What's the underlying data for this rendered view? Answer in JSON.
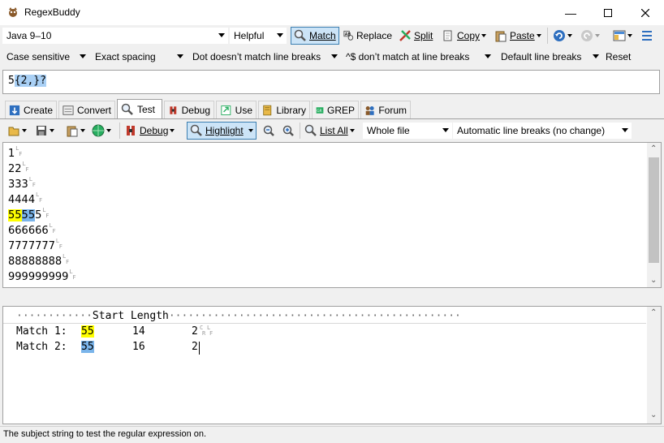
{
  "window": {
    "title": "RegexBuddy"
  },
  "toolbar1": {
    "flavor": "Java 9–10",
    "helpful": "Helpful",
    "match": "Match",
    "replace": "Replace",
    "split": "Split",
    "copy": "Copy",
    "paste": "Paste"
  },
  "toolbar2": {
    "case": "Case sensitive",
    "spacing": "Exact spacing",
    "dot": "Dot doesn’t match line breaks",
    "anchors": "^$ don’t match at line breaks",
    "linebreaks": "Default line breaks",
    "reset": "Reset"
  },
  "regex": {
    "p1": "5",
    "p2": "{2,}?"
  },
  "tabs": [
    {
      "label": "Create"
    },
    {
      "label": "Convert"
    },
    {
      "label": "Test"
    },
    {
      "label": "Debug"
    },
    {
      "label": "Use"
    },
    {
      "label": "Library"
    },
    {
      "label": "GREP"
    },
    {
      "label": "Forum"
    }
  ],
  "testbar": {
    "debug": "Debug",
    "highlight": "Highlight",
    "list_all": "List All",
    "scope": "Whole file",
    "line_breaks": "Automatic line breaks (no change)"
  },
  "subject": {
    "lines": [
      "1",
      "22",
      "333",
      "4444",
      "55555",
      "666666",
      "7777777",
      "88888888",
      "999999999"
    ],
    "m1": "55",
    "m2": "55",
    "rest": "5"
  },
  "results": {
    "header": "Start Length",
    "rows": [
      {
        "label": "Match 1:",
        "text": "55",
        "start": "14",
        "length": "2"
      },
      {
        "label": "Match 2:",
        "text": "55",
        "start": "16",
        "length": "2"
      }
    ]
  },
  "status": {
    "text": "The subject string to test the regular expression on."
  },
  "colors": {
    "match1": "#ffff00",
    "match2": "#7ab4ea",
    "accent": "#3c7fb1"
  }
}
